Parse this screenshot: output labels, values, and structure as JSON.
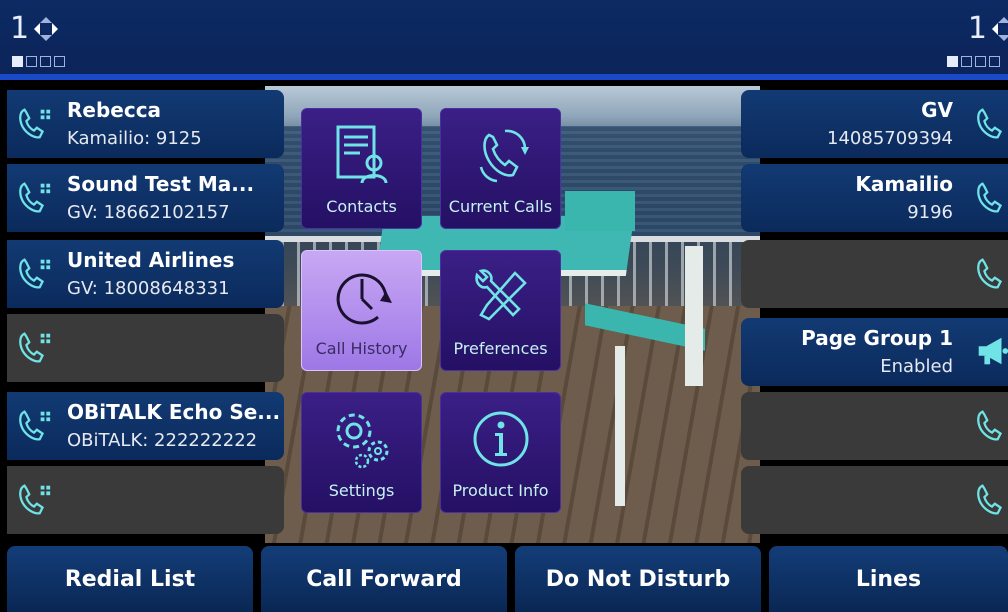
{
  "topbar": {
    "left_page_number": "1",
    "right_page_number": "1"
  },
  "left_keys": [
    {
      "name": "Rebecca",
      "sub": "Kamailio: 9125"
    },
    {
      "name": "Sound Test Ma...",
      "sub": "GV: 18662102157"
    },
    {
      "name": "United Airlines",
      "sub": "GV: 18008648331"
    },
    {
      "name": "",
      "sub": ""
    },
    {
      "name": "OBiTALK Echo Se...",
      "sub": "OBiTALK: 222222222"
    },
    {
      "name": "",
      "sub": ""
    }
  ],
  "right_keys": [
    {
      "name": "GV",
      "sub": "14085709394"
    },
    {
      "name": "Kamailio",
      "sub": "9196"
    },
    {
      "name": "",
      "sub": ""
    },
    {
      "name": "Page Group 1",
      "sub": "Enabled"
    },
    {
      "name": "",
      "sub": ""
    },
    {
      "name": "",
      "sub": ""
    }
  ],
  "menu": {
    "contacts": "Contacts",
    "current_calls": "Current Calls",
    "call_history": "Call History",
    "preferences": "Preferences",
    "settings": "Settings",
    "product_info": "Product Info",
    "selected": "Call History"
  },
  "softkeys": {
    "redial": "Redial List",
    "forward": "Call Forward",
    "dnd": "Do Not Disturb",
    "lines": "Lines"
  },
  "icons": {
    "line_key": "phone-handset-icon",
    "page_group": "megaphone-icon"
  },
  "colors": {
    "key_blue": "#0b2a5c",
    "tile_purple": "#2b1570",
    "tile_selected": "#b391ee",
    "icon_teal": "#6fe3e6"
  }
}
